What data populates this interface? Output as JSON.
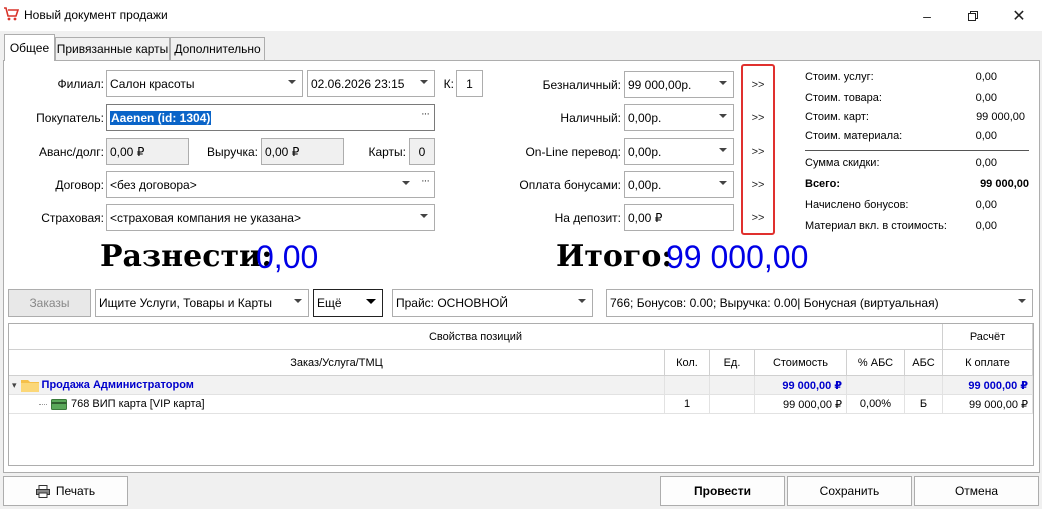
{
  "window": {
    "title": "Новый документ продажи"
  },
  "tabs": [
    "Общее",
    "Привязанные карты",
    "Дополнительно"
  ],
  "form": {
    "branch_label": "Филиал:",
    "branch_value": "Салон красоты",
    "date_value": "02.06.2026 23:15",
    "k_label": "К:",
    "k_value": "1",
    "buyer_label": "Покупатель:",
    "buyer_value": "Aaenen  (id: 1304)",
    "advance_label": "Аванс/долг:",
    "advance_value": "0,00 ₽",
    "revenue_label": "Выручка:",
    "revenue_value": "0,00 ₽",
    "cards_label": "Карты:",
    "cards_value": "0",
    "contract_label": "Договор:",
    "contract_value": "<без договора>",
    "insurance_label": "Страховая:",
    "insurance_value": "<страховая компания не указана>"
  },
  "payments": [
    {
      "label": "Безналичный:",
      "value": "99 000,00р."
    },
    {
      "label": "Наличный:",
      "value": "0,00р."
    },
    {
      "label": "On-Line перевод:",
      "value": "0,00р."
    },
    {
      "label": "Оплата бонусами:",
      "value": "0,00р."
    },
    {
      "label": "На депозит:",
      "value": "0,00 ₽"
    }
  ],
  "arrow_label": ">>",
  "summary": [
    {
      "label": "Стоим. услуг:",
      "value": "0,00"
    },
    {
      "label": "Стоим. товара:",
      "value": "0,00"
    },
    {
      "label": "Стоим. карт:",
      "value": "99 000,00"
    },
    {
      "label": "Стоим. материала:",
      "value": "0,00"
    },
    {
      "label": "Сумма скидки:",
      "value": "0,00"
    },
    {
      "label": "Всего:",
      "value": "99 000,00"
    },
    {
      "label": "Начислено бонусов:",
      "value": "0,00"
    },
    {
      "label": "Материал вкл. в стоимость:",
      "value": "0,00"
    }
  ],
  "totals": {
    "distribute_label": "Разнести:",
    "distribute_value": "0,00",
    "total_label": "Итого:",
    "total_value": "99 000,00"
  },
  "toolbar": {
    "orders_label": "Заказы",
    "search_placeholder": "Ищите Услуги, Товары и Карты",
    "more_label": "Ещё",
    "price_value": "Прайс: ОСНОВНОЙ",
    "card_info": "766; Бонусов: 0.00; Выручка: 0.00| Бонусная (виртуальная)"
  },
  "table": {
    "band_props": "Свойства позиций",
    "band_calc": "Расчёт",
    "columns": [
      "Заказ/Услуга/ТМЦ",
      "Кол.",
      "Ед.",
      "Стоимость",
      "% АБС",
      "АБС",
      "К оплате"
    ],
    "group": {
      "name": "Продажа Администратором",
      "cost": "99 000,00 ₽",
      "pay": "99 000,00 ₽"
    },
    "rows": [
      {
        "name": "768 ВИП карта [VIP карта]",
        "qty": "1",
        "unit": "",
        "cost": "99 000,00 ₽",
        "abs_pct": "0,00%",
        "abs": "Б",
        "pay": "99 000,00 ₽"
      }
    ]
  },
  "buttons": {
    "print": "Печать",
    "post": "Провести",
    "save": "Сохранить",
    "cancel": "Отмена"
  }
}
